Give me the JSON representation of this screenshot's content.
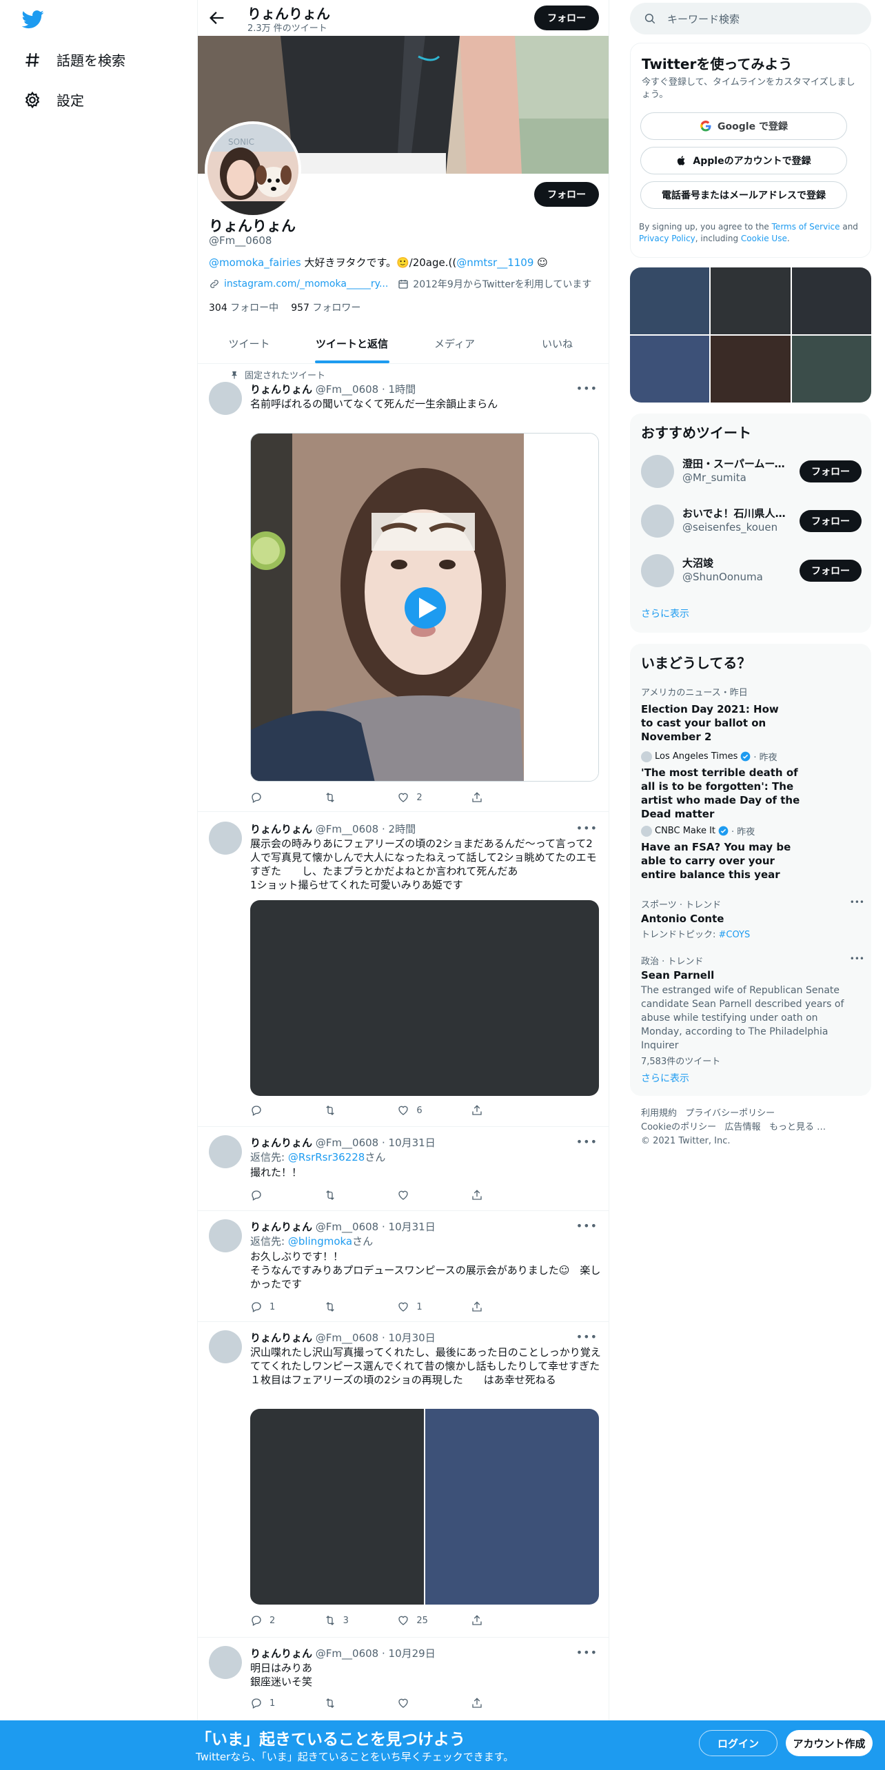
{
  "nav": {
    "explore_label": "話題を検索",
    "settings_label": "設定"
  },
  "header": {
    "name": "りょんりょん",
    "tweet_count": "2.3万 件のツイート",
    "follow_label": "フォロー"
  },
  "profile": {
    "name": "りょんりょん",
    "handle": "@Fm__0608",
    "follow_label": "フォロー",
    "bio": {
      "mention1": "@momoka_fairies",
      "text1": " 大好きヲタクです。🙂/20age.((",
      "mention2": "@nmtsr__1109",
      "text2": " ☺"
    },
    "website": "instagram.com/_momoka_____ry...",
    "joined": "2012年9月からTwitterを利用しています",
    "following_count": "304",
    "following_label": " フォロー中",
    "followers_count": "957",
    "followers_label": " フォロワー"
  },
  "tabs": [
    "ツイート",
    "ツイートと返信",
    "メディア",
    "いいね"
  ],
  "pinned_label": "固定されたツイート",
  "tweets": [
    {
      "name": "りょんりょん",
      "handle": "@Fm__0608",
      "time": " · 1時間",
      "text": "名前呼ばれるの聞いてなくて死んだ一生余韻止まらん",
      "reply": "",
      "retweet": "",
      "like": "2"
    },
    {
      "name": "りょんりょん",
      "handle": "@Fm__0608",
      "time": " · 2時間",
      "text": "展示会の時みりあにフェアリーズの頃の2ショまだあるんだ〜って言って2人で写真見て懐かしんで大人になったねえって話して2ショ眺めてたのエモすぎた　　し、たまプラとかだよねとか言われて死んだあ\n1ショット撮らせてくれた可愛いみりあ姫です",
      "reply": "",
      "retweet": "",
      "like": "6"
    },
    {
      "name": "りょんりょん",
      "handle": "@Fm__0608",
      "time": " · 10月31日",
      "reply_to_prefix": "返信先: ",
      "reply_to": "@RsrRsr36228",
      "reply_to_suffix": "さん",
      "text": "撮れた！！",
      "reply": "",
      "retweet": "",
      "like": ""
    },
    {
      "name": "りょんりょん",
      "handle": "@Fm__0608",
      "time": " · 10月31日",
      "reply_to_prefix": "返信先: ",
      "reply_to": "@blingmoka",
      "reply_to_suffix": "さん",
      "text": "お久しぶりです！！\nそうなんですみりあプロデュースワンピースの展示会がありました☺︎　楽しかったです",
      "reply": "1",
      "retweet": "",
      "like": "1"
    },
    {
      "name": "りょんりょん",
      "handle": "@Fm__0608",
      "time": " · 10月30日",
      "text": "沢山喋れたし沢山写真撮ってくれたし、最後にあった日のことしっかり覚えててくれたしワンピース選んでくれて昔の懐かし話もしたりして幸せすぎた\n１枚目はフェアリーズの頃の2ショの再現した　　はあ幸せ死ねる",
      "reply": "2",
      "retweet": "3",
      "like": "25"
    },
    {
      "name": "りょんりょん",
      "handle": "@Fm__0608",
      "time": " · 10月29日",
      "text": "明日はみりあ\n銀座迷いそ笑",
      "reply": "1",
      "retweet": "",
      "like": ""
    }
  ],
  "search": {
    "placeholder": "キーワード検索"
  },
  "signup_box": {
    "title": "Twitterを使ってみよう",
    "subtitle": "今すぐ登録して、タイムラインをカスタマイズしましょう。",
    "google": "Google で登録",
    "apple": "Appleのアカウントで登録",
    "phone": "電話番号またはメールアドレスで登録",
    "terms_prefix": "By signing up, you agree to the ",
    "terms_link": "Terms of Service",
    "terms_and": " and ",
    "privacy_link": "Privacy Policy",
    "including": ", including ",
    "cookie_link": "Cookie Use",
    "period": "."
  },
  "recommended": {
    "title": "おすすめツイート",
    "follow_label": "フォロー",
    "accounts": [
      {
        "name": "澄田・スーパームーン…",
        "handle": "@Mr_sumita"
      },
      {
        "name": "おいでよ！石川県人会…",
        "handle": "@seisenfes_kouen"
      },
      {
        "name": "大沼竣",
        "handle": "@ShunOonuma"
      }
    ],
    "show_more": "さらに表示"
  },
  "trends": {
    "title": "いまどうしてる？",
    "items": [
      {
        "context": "アメリカのニュース・昨日",
        "title": "Election Day 2021: How to cast your ballot on November 2"
      },
      {
        "source": "Los Angeles Times",
        "time": " · 昨夜",
        "title": "'The most terrible death of all is to be forgotten': The artist who made Day of the Dead matter"
      },
      {
        "source": "CNBC Make It",
        "time": " · 昨夜",
        "title": "Have an FSA? You may be able to carry over your entire balance this year"
      },
      {
        "context": "スポーツ · トレンド",
        "title": "Antonio Conte",
        "sub_prefix": "トレンドトピック: ",
        "sub_link": "#COYS"
      },
      {
        "context": "政治 · トレンド",
        "title": "Sean Parnell",
        "body": "The estranged wife of Republican Senate candidate Sean Parnell described years of abuse while testifying under oath on Monday, according to The Philadelphia Inquirer",
        "sub": "7,583件のツイート"
      }
    ],
    "show_more": "さらに表示"
  },
  "footer": {
    "terms": "利用規約",
    "privacy": "プライバシーポリシー",
    "cookie": "Cookieのポリシー",
    "ads": "広告情報",
    "more": "もっと見る …",
    "copyright": "© 2021 Twitter, Inc."
  },
  "bottom_banner": {
    "title": "「いま」起きていることを見つけよう",
    "subtitle": "Twitterなら、「いま」起きていることをいち早くチェックできます。",
    "login": "ログイン",
    "signup": "アカウント作成"
  },
  "colors": {
    "accent": "#1d9bf0",
    "text": "#0f1419",
    "muted": "#536471",
    "button_dark": "#0f1419"
  }
}
